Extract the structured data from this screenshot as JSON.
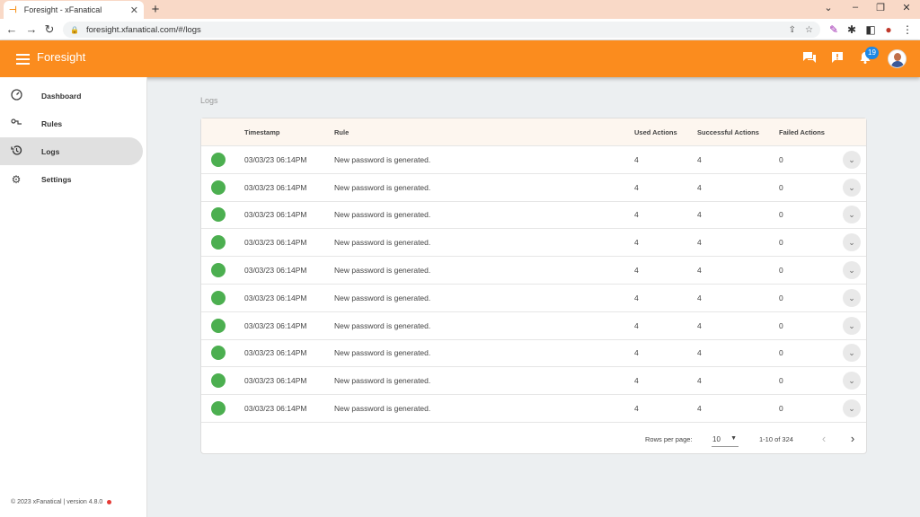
{
  "browser": {
    "tab_title": "Foresight - xFanatical",
    "url": "foresight.xfanatical.com/#/logs"
  },
  "app": {
    "title": "Foresight",
    "notification_count": "19"
  },
  "sidebar": {
    "items": [
      {
        "label": "Dashboard",
        "icon": "dashboard-icon"
      },
      {
        "label": "Rules",
        "icon": "rules-icon"
      },
      {
        "label": "Logs",
        "icon": "history-icon",
        "active": true
      },
      {
        "label": "Settings",
        "icon": "gear-icon"
      }
    ],
    "footer": "© 2023 xFanatical | version 4.8.0"
  },
  "main": {
    "page_title": "Logs",
    "columns": [
      "Timestamp",
      "Rule",
      "Used Actions",
      "Successful Actions",
      "Failed Actions"
    ],
    "rows": [
      {
        "timestamp": "03/03/23 06:14PM",
        "rule": "New password is generated.",
        "used": "4",
        "successful": "4",
        "failed": "0"
      },
      {
        "timestamp": "03/03/23 06:14PM",
        "rule": "New password is generated.",
        "used": "4",
        "successful": "4",
        "failed": "0"
      },
      {
        "timestamp": "03/03/23 06:14PM",
        "rule": "New password is generated.",
        "used": "4",
        "successful": "4",
        "failed": "0"
      },
      {
        "timestamp": "03/03/23 06:14PM",
        "rule": "New password is generated.",
        "used": "4",
        "successful": "4",
        "failed": "0"
      },
      {
        "timestamp": "03/03/23 06:14PM",
        "rule": "New password is generated.",
        "used": "4",
        "successful": "4",
        "failed": "0"
      },
      {
        "timestamp": "03/03/23 06:14PM",
        "rule": "New password is generated.",
        "used": "4",
        "successful": "4",
        "failed": "0"
      },
      {
        "timestamp": "03/03/23 06:14PM",
        "rule": "New password is generated.",
        "used": "4",
        "successful": "4",
        "failed": "0"
      },
      {
        "timestamp": "03/03/23 06:14PM",
        "rule": "New password is generated.",
        "used": "4",
        "successful": "4",
        "failed": "0"
      },
      {
        "timestamp": "03/03/23 06:14PM",
        "rule": "New password is generated.",
        "used": "4",
        "successful": "4",
        "failed": "0"
      },
      {
        "timestamp": "03/03/23 06:14PM",
        "rule": "New password is generated.",
        "used": "4",
        "successful": "4",
        "failed": "0"
      }
    ],
    "pagination": {
      "rows_per_page_label": "Rows per page:",
      "rows_per_page": "10",
      "range": "1-10 of 324"
    }
  },
  "colors": {
    "brand": "#fb8c1e",
    "status_success": "#4caf50",
    "badge": "#1e88e5"
  }
}
